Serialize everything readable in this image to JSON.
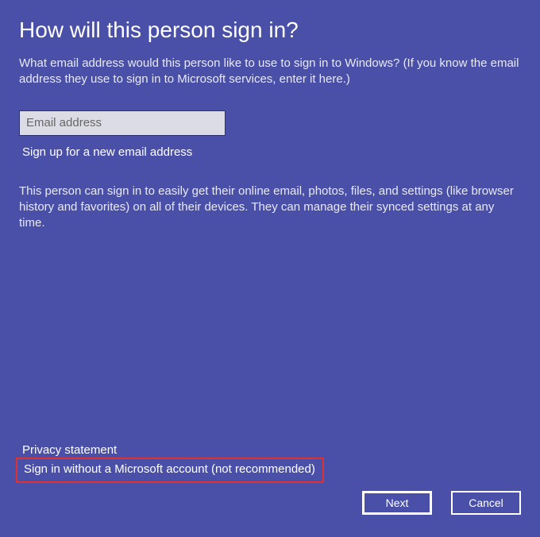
{
  "title": "How will this person sign in?",
  "intro": "What email address would this person like to use to sign in to Windows? (If you know the email address they use to sign in to Microsoft services, enter it here.)",
  "email": {
    "placeholder": "Email address",
    "value": ""
  },
  "signup_link": "Sign up for a new email address",
  "description": "This person can sign in to easily get their online email, photos, files, and settings (like browser history and favorites) on all of their devices. They can manage their synced settings at any time.",
  "privacy_link": "Privacy statement",
  "no_account_link": "Sign in without a Microsoft account (not recommended)",
  "buttons": {
    "next": "Next",
    "cancel": "Cancel"
  }
}
